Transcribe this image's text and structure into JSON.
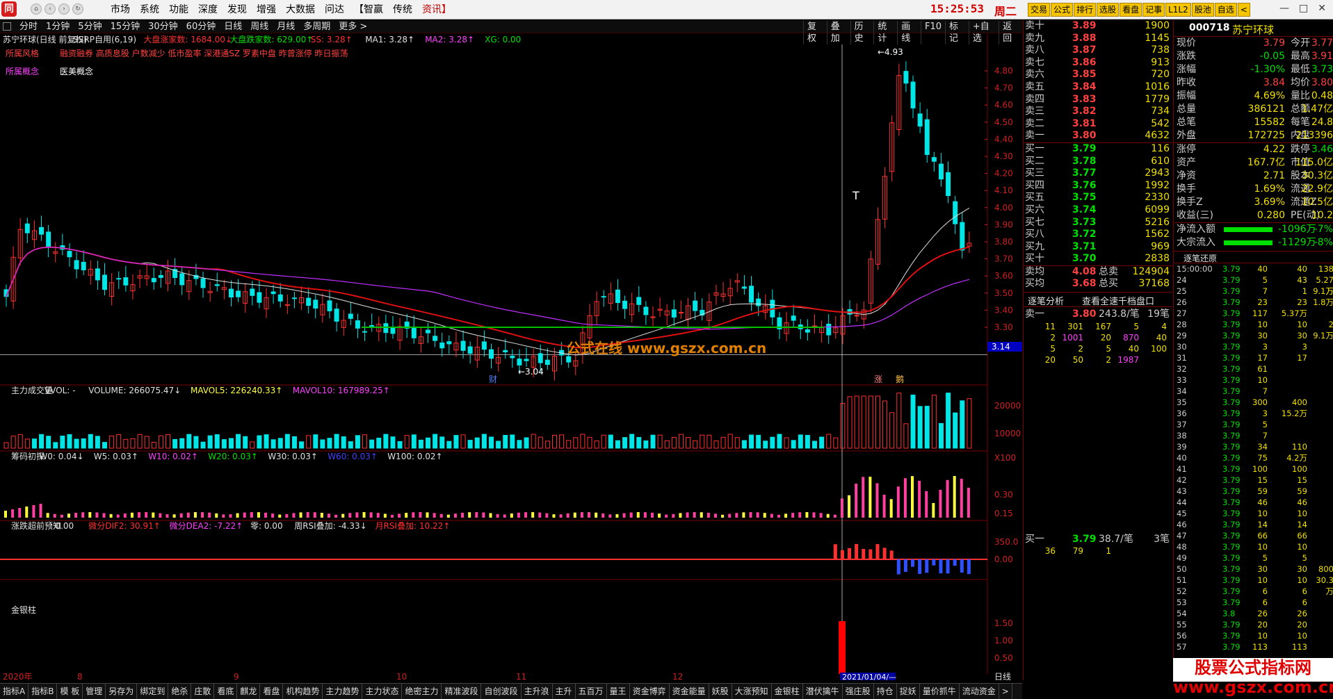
{
  "titlebar": {
    "menu": [
      "市场",
      "系统",
      "功能",
      "深度",
      "发现",
      "增强",
      "大数据",
      "问达",
      "【智赢",
      "传统",
      "资讯】"
    ],
    "clock": "15:25:53",
    "weekday": "周二",
    "right_buttons": [
      "交易",
      "公式",
      "排行",
      "选股",
      "看盘",
      "记事",
      "L1L2",
      "股池",
      "自选",
      "<"
    ],
    "window_controls": [
      "—",
      "□",
      "✕"
    ]
  },
  "periodbar": {
    "periods": [
      "分时",
      "1分钟",
      "5分钟",
      "15分钟",
      "30分钟",
      "60分钟",
      "日线",
      "周线",
      "月线",
      "多周期",
      "更多 >"
    ],
    "tools": [
      "复权",
      "叠加",
      "历史",
      "统计",
      "画线",
      "F10",
      "标记",
      "+自选",
      "返回"
    ]
  },
  "main_header": {
    "stock": "苏宁环球(日线 前复权)",
    "ssrp": "SSRP自用(6,19)",
    "up_count": "大盘涨家数: 1684.00↓",
    "down_count": "大盘跌家数: 629.00↑",
    "ss": "SS: 3.28↑",
    "ma1": "MA1: 3.28↑",
    "ma2": "MA2: 3.28↑",
    "xg": "XG: 0.00"
  },
  "style_row": {
    "label": "所属风格",
    "value": "融资融券 高质息股 户数减少 低市盈率 深港通SZ 罗素中盘 昨曾涨停 昨日振荡"
  },
  "concept_row": {
    "label": "所属概念",
    "value": "医美概念"
  },
  "price_axis": [
    "4.80",
    "4.70",
    "4.60",
    "4.50",
    "4.40",
    "4.30",
    "4.20",
    "4.10",
    "4.00",
    "3.90",
    "3.80",
    "3.70",
    "3.60",
    "3.50",
    "3.40",
    "3.30"
  ],
  "price_axis_current": "3.14",
  "chart_labels": {
    "high": "4.93",
    "low": "3.04",
    "t_mark": "T",
    "cai": "财",
    "zhang": "涨",
    "jing": "鹅",
    "watermark": "公式在线  www.gszx.com.cn"
  },
  "vol_header": {
    "name": "主力成交量",
    "vvol": "VVOL: -",
    "volume": "VOLUME: 266075.47↓",
    "mavol5": "MAVOL5: 226240.33↑",
    "mavol10": "MAVOL10: 167989.25↑"
  },
  "vol_axis": [
    "20000",
    "10000",
    "X100"
  ],
  "chip_header": {
    "name": "筹码初探",
    "w0": "W0: 0.04↓",
    "w5": "W5: 0.03↑",
    "w10": "W10: 0.02↑",
    "w20": "W20: 0.03↑",
    "w30": "W30: 0.03↑",
    "w60": "W60: 0.03↑",
    "w100": "W100: 0.02↑"
  },
  "chip_axis": [
    "0.30",
    "0.15"
  ],
  "macd_header": {
    "name": "涨跌超前预知",
    "v": ": 0.00",
    "dif": "微分DIF2: 30.91↑",
    "dea": "微分DEA2: -7.22↑",
    "zero": "零: 0.00",
    "week_rsi": "周RSI叠加: -4.33↓",
    "month_rsi": "月RSI叠加: 10.22↑"
  },
  "macd_axis": [
    "350.0",
    "0.00"
  ],
  "gold_header": {
    "name": "金银柱"
  },
  "gold_axis": [
    "1.50",
    "1.00",
    "0.50"
  ],
  "date_axis": {
    "year": "2020年",
    "m8": "8",
    "m9": "9",
    "m10": "10",
    "m11": "11",
    "m12": "12",
    "cursor": "2021/01/04/—",
    "period": "日线"
  },
  "bottom_tabs": [
    "指标A",
    "指标B",
    "模 板",
    "管理",
    "另存为",
    "绑定到",
    "绝杀",
    "庄散",
    "看底",
    "麒龙",
    "看盘",
    "机构趋势",
    "主力趋势",
    "主力状态",
    "绝密主力",
    "精准波段",
    "自创波段",
    "主升浪",
    "主升",
    "五百万",
    "量王",
    "资金博弈",
    "资金能量",
    "妖股",
    "大涨预知",
    "金银柱",
    "潜伏擒牛",
    "强庄股",
    "持仓",
    "捉妖",
    "量价抓牛",
    "流动资金",
    ">"
  ],
  "sell_levels": [
    {
      "label": "卖十",
      "price": "3.89",
      "vol": "1900"
    },
    {
      "label": "卖九",
      "price": "3.88",
      "vol": "1145"
    },
    {
      "label": "卖八",
      "price": "3.87",
      "vol": "738"
    },
    {
      "label": "卖七",
      "price": "3.86",
      "vol": "913"
    },
    {
      "label": "卖六",
      "price": "3.85",
      "vol": "720"
    },
    {
      "label": "卖五",
      "price": "3.84",
      "vol": "1016"
    },
    {
      "label": "卖四",
      "price": "3.83",
      "vol": "1779"
    },
    {
      "label": "卖三",
      "price": "3.82",
      "vol": "734"
    },
    {
      "label": "卖二",
      "price": "3.81",
      "vol": "542"
    },
    {
      "label": "卖一",
      "price": "3.80",
      "vol": "4632"
    }
  ],
  "buy_levels": [
    {
      "label": "买一",
      "price": "3.79",
      "vol": "116"
    },
    {
      "label": "买二",
      "price": "3.78",
      "vol": "610"
    },
    {
      "label": "买三",
      "price": "3.77",
      "vol": "2943"
    },
    {
      "label": "买四",
      "price": "3.76",
      "vol": "1992"
    },
    {
      "label": "买五",
      "price": "3.75",
      "vol": "2330"
    },
    {
      "label": "买六",
      "price": "3.74",
      "vol": "6099"
    },
    {
      "label": "买七",
      "price": "3.73",
      "vol": "5216"
    },
    {
      "label": "买八",
      "price": "3.72",
      "vol": "1562"
    },
    {
      "label": "买九",
      "price": "3.71",
      "vol": "969"
    },
    {
      "label": "买十",
      "price": "3.70",
      "vol": "2838"
    }
  ],
  "avg_rows": [
    {
      "label": "卖均",
      "price": "4.08",
      "tlabel": "总卖",
      "total": "124904"
    },
    {
      "label": "买均",
      "price": "3.68",
      "tlabel": "总买",
      "total": "37168"
    }
  ],
  "analysis": {
    "btn1": "逐笔分析",
    "btn2": "查看全速千档盘口",
    "sell1": {
      "label": "卖一",
      "price": "3.80",
      "per": "243.8/笔",
      "count": "19笔"
    },
    "sell1_orders": [
      [
        "11",
        "301",
        "167",
        "5",
        "4"
      ],
      [
        "2",
        "1001",
        "20",
        "870",
        "40"
      ],
      [
        "5",
        "2",
        "5",
        "40",
        "100"
      ],
      [
        "20",
        "50",
        "2",
        "1987",
        ""
      ]
    ],
    "buy1": {
      "label": "买一",
      "price": "3.79",
      "per": "38.7/笔",
      "count": "3笔"
    },
    "buy1_orders": [
      "36",
      "79",
      "1"
    ]
  },
  "quote": {
    "code": "000718",
    "name": "苏宁环球",
    "rows": [
      [
        "现价",
        "3.79",
        "今开",
        "3.77"
      ],
      [
        "涨跌",
        "-0.05",
        "最高",
        "3.91"
      ],
      [
        "涨幅",
        "-1.30%",
        "最低",
        "3.73"
      ],
      [
        "昨收",
        "3.84",
        "均价",
        "3.80"
      ],
      [
        "振幅",
        "4.69%",
        "量比",
        "0.48"
      ],
      [
        "总量",
        "386121",
        "总额",
        "1.47亿"
      ],
      [
        "总笔",
        "15582",
        "每笔",
        "24.8"
      ],
      [
        "外盘",
        "172725",
        "内盘",
        "213396"
      ]
    ],
    "rows2": [
      [
        "涨停",
        "4.22",
        "跌停",
        "3.46"
      ],
      [
        "资产",
        "167.7亿",
        "市值",
        "115.0亿"
      ],
      [
        "净资",
        "2.71",
        "股本",
        "30.3亿"
      ],
      [
        "换手",
        "1.69%",
        "流通",
        "22.9亿"
      ],
      [
        "换手Z",
        "3.69%",
        "流通Z",
        "10.5亿"
      ],
      [
        "收益(三)",
        "0.280",
        "PE(动)",
        "10.2"
      ]
    ],
    "flows": [
      {
        "label": "净流入额",
        "value": "-1096万",
        "pct": "-7%"
      },
      {
        "label": "大宗流入",
        "value": "-1129万",
        "pct": "-8%"
      }
    ],
    "tick_title": "逐笔还原"
  },
  "ticks": [
    [
      "15:00:00",
      "3.79",
      "40",
      "40",
      "138"
    ],
    [
      "24",
      "3.79",
      "5",
      "43",
      "5.27万"
    ],
    [
      "25",
      "3.79",
      "7",
      "1",
      "9.1万"
    ],
    [
      "26",
      "3.79",
      "23",
      "23",
      "1.8万"
    ],
    [
      "27",
      "3.79",
      "117",
      "5.37万",
      ""
    ],
    [
      "28",
      "3.79",
      "10",
      "10",
      "2"
    ],
    [
      "29",
      "3.79",
      "30",
      "30",
      "9.1万"
    ],
    [
      "30",
      "3.79",
      "3",
      "3",
      ""
    ],
    [
      "31",
      "3.79",
      "17",
      "17",
      ""
    ],
    [
      "32",
      "3.79",
      "61",
      "",
      ""
    ],
    [
      "33",
      "3.79",
      "10",
      "",
      ""
    ],
    [
      "34",
      "3.79",
      "7",
      "",
      ""
    ],
    [
      "35",
      "3.79",
      "300",
      "400",
      ""
    ],
    [
      "36",
      "3.79",
      "3",
      "15.2万",
      ""
    ],
    [
      "37",
      "3.79",
      "5",
      "",
      ""
    ],
    [
      "38",
      "3.79",
      "7",
      "",
      ""
    ],
    [
      "39",
      "3.79",
      "34",
      "110",
      ""
    ],
    [
      "40",
      "3.79",
      "75",
      "4.2万",
      ""
    ],
    [
      "41",
      "3.79",
      "100",
      "100",
      ""
    ],
    [
      "42",
      "3.79",
      "15",
      "15",
      ""
    ],
    [
      "43",
      "3.79",
      "59",
      "59",
      ""
    ],
    [
      "44",
      "3.79",
      "46",
      "46",
      ""
    ],
    [
      "45",
      "3.79",
      "10",
      "10",
      ""
    ],
    [
      "46",
      "3.79",
      "14",
      "14",
      ""
    ],
    [
      "47",
      "3.79",
      "66",
      "66",
      ""
    ],
    [
      "48",
      "3.79",
      "10",
      "10",
      ""
    ],
    [
      "49",
      "3.79",
      "5",
      "5",
      ""
    ],
    [
      "50",
      "3.79",
      "30",
      "30",
      "800"
    ],
    [
      "51",
      "3.79",
      "10",
      "10",
      "30.3万"
    ],
    [
      "52",
      "3.79",
      "6",
      "6",
      ""
    ],
    [
      "53",
      "3.79",
      "6",
      "6",
      ""
    ],
    [
      "54",
      "3.8",
      "26",
      "26",
      ""
    ],
    [
      "55",
      "3.79",
      "20",
      "20",
      ""
    ],
    [
      "56",
      "3.79",
      "10",
      "10",
      ""
    ],
    [
      "57",
      "3.79",
      "113",
      "113",
      ""
    ]
  ],
  "brand": "股票公式指标网 www.gszx.com.cn",
  "colors": {
    "up": "#ff3030",
    "down": "#00e5e5",
    "ma_red": "#e01010",
    "ma_white": "#e0e0e0",
    "ma_purple": "#c030ff",
    "ma_green": "#00c000",
    "bg": "#000000",
    "grid": "#7a0000"
  },
  "chart_data": {
    "type": "candlestick",
    "title": "苏宁环球(日线 前复权)",
    "ylim": [
      3.0,
      4.95
    ],
    "last_close": 3.79,
    "high": 4.93,
    "low": 3.04
  }
}
